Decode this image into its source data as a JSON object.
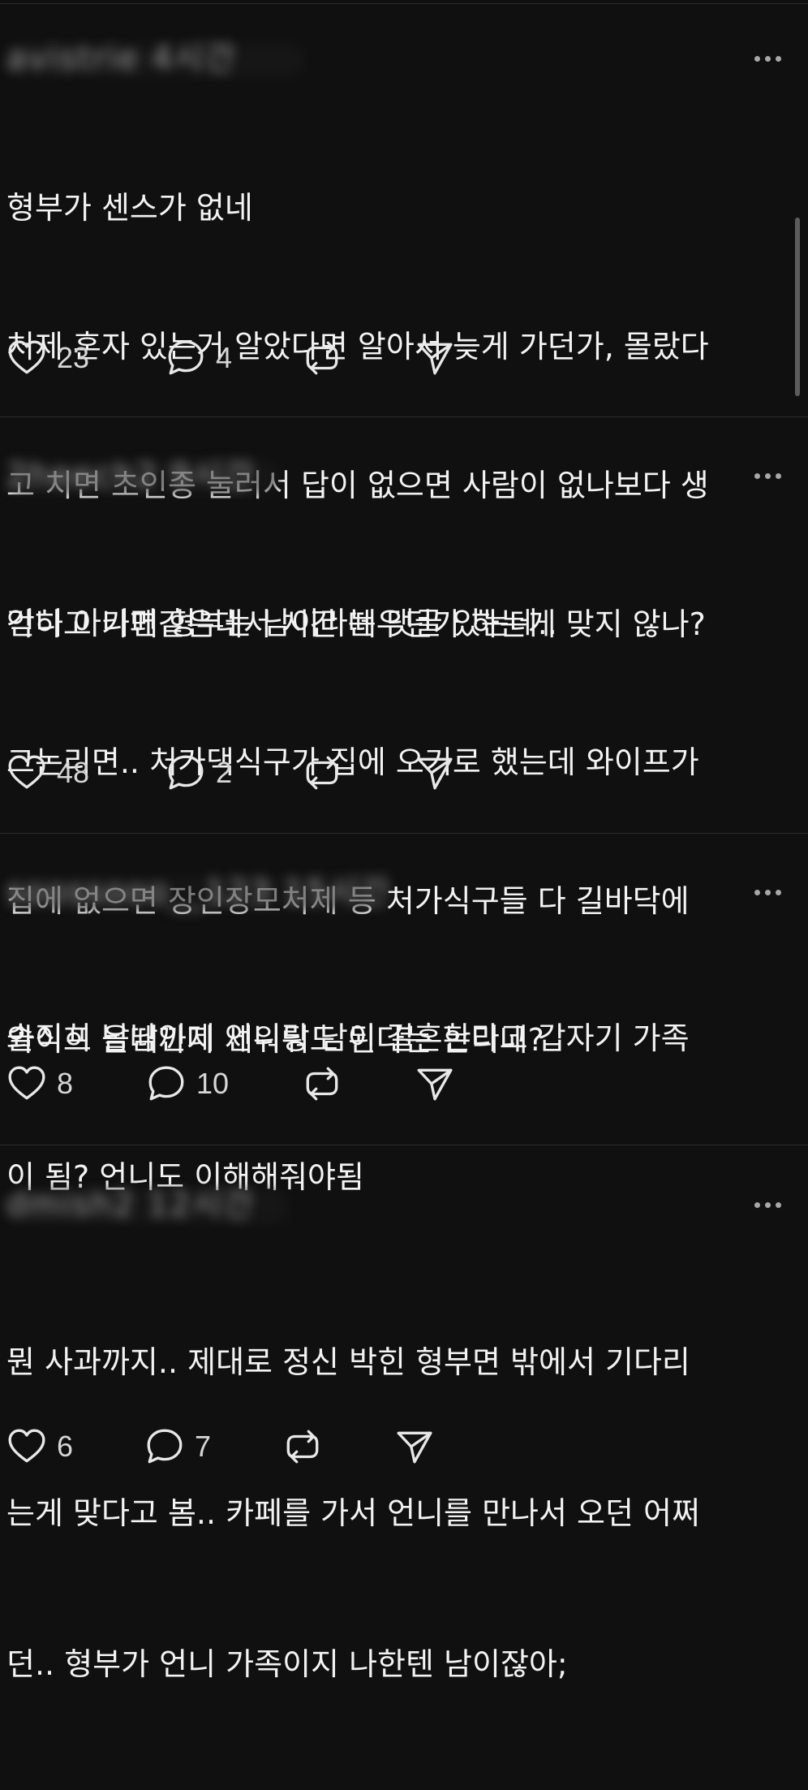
{
  "posts": [
    {
      "username": "avistrie",
      "time": "4시간",
      "lines": [
        "형부가 센스가 없네",
        "처제 혼자 있는거 알았다면 알아서 늦게 가던가, 몰랐다",
        "고 치면 초인종 눌러서 답이 없으면 사람이 없나보다 생",
        "각하고 카페같은데서 시간 떼우던가 하는게 맞지 않나?"
      ],
      "likes": "23",
      "replies": "4"
    },
    {
      "username": "2heech2",
      "time": "9시간",
      "lines": [
        "언니 아니면 형부는 남이라는 댓글 있는데..",
        "그논리면.. 처가댁식구가 집에 오기로 했는데 와이프가",
        "집에 없으면 장인장모처제 등 처가식구들 다 길바닥에",
        "와이프 올때까지 세워둬도 된다는 논리네?"
      ],
      "likes": "48",
      "replies": "2"
    },
    {
      "username": "soossooo__123",
      "time": "15시간",
      "lines": [
        "솔직히 남남인데 언니랑 남이 결혼한다고 갑자기 가족",
        "이 됨? 언니도 이해해줘야됨"
      ],
      "likes": "8",
      "replies": "10"
    },
    {
      "username": "dmish2",
      "time": "12시간",
      "lines": [
        "뭔 사과까지.. 제대로 정신 박힌 형부면 밖에서 기다리",
        "는게 맞다고 봄.. 카페를 가서 언니를 만나서 오던 어쩌",
        "던.. 형부가 언니 가족이지 나한텐 남이잖아;"
      ],
      "likes": "6",
      "replies": "7"
    }
  ],
  "icons": {
    "like": "heart-icon",
    "reply": "comment-bubble-icon",
    "repost": "repost-icon",
    "share": "send-icon",
    "more": "more-dots-icon"
  }
}
